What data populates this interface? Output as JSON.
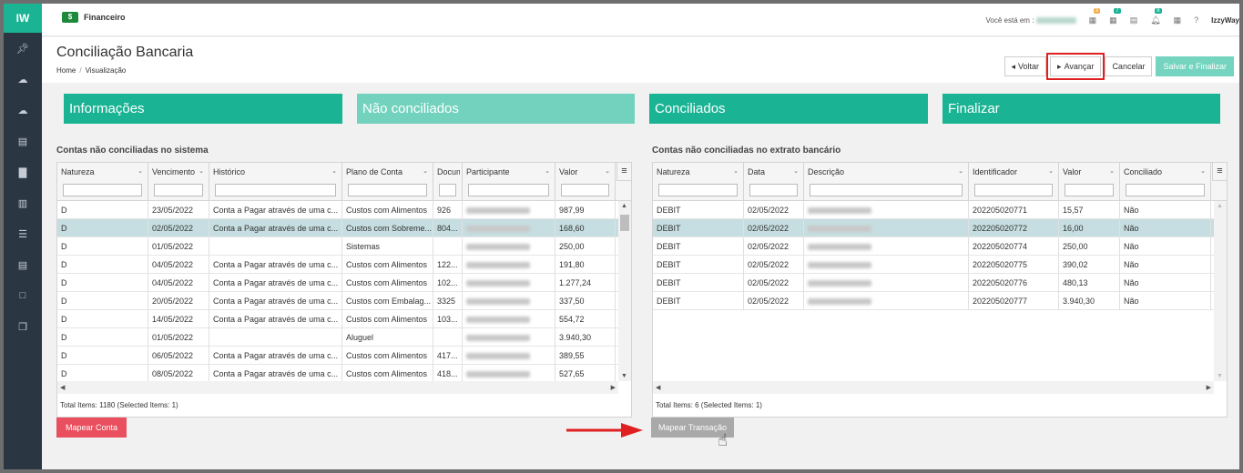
{
  "app": {
    "logo": "IW",
    "module": "Financeiro"
  },
  "topbar": {
    "location_label": "Você está em :",
    "user": "IzzyWay",
    "badges": [
      "3",
      "7",
      "8"
    ]
  },
  "sidebar": {
    "icons": [
      "pin-icon",
      "cloud-upload-icon",
      "cloud-upload-icon",
      "card-icon",
      "bar-chart-icon",
      "book-icon",
      "list-icon",
      "card-icon",
      "document-icon",
      "copy-icon"
    ]
  },
  "page": {
    "title": "Conciliação Bancaria",
    "breadcrumb": [
      "Home",
      "Visualização"
    ]
  },
  "actions": {
    "voltar": "Voltar",
    "avancar": "Avançar",
    "cancelar": "Cancelar",
    "salvar": "Salvar e Finalizar"
  },
  "steps": [
    "Informações",
    "Não conciliados",
    "Conciliados",
    "Finalizar"
  ],
  "left": {
    "title": "Contas não conciliadas no sistema",
    "columns": [
      "Natureza",
      "Vencimento",
      "Histórico",
      "Plano de Conta",
      "Documento",
      "Participante",
      "Valor"
    ],
    "rows": [
      [
        "D",
        "23/05/2022",
        "Conta a Pagar através de uma c...",
        "Custos com Alimentos",
        "926",
        "",
        "987,99"
      ],
      [
        "D",
        "02/05/2022",
        "Conta a Pagar através de uma c...",
        "Custos com Sobreme...",
        "804...",
        "",
        "168,60"
      ],
      [
        "D",
        "01/05/2022",
        "",
        "Sistemas",
        "",
        "",
        "250,00"
      ],
      [
        "D",
        "04/05/2022",
        "Conta a Pagar através de uma c...",
        "Custos com Alimentos",
        "122...",
        "",
        "191,80"
      ],
      [
        "D",
        "04/05/2022",
        "Conta a Pagar através de uma c...",
        "Custos com Alimentos",
        "102...",
        "",
        "1.277,24"
      ],
      [
        "D",
        "20/05/2022",
        "Conta a Pagar através de uma c...",
        "Custos com Embalag...",
        "3325",
        "",
        "337,50"
      ],
      [
        "D",
        "14/05/2022",
        "Conta a Pagar através de uma c...",
        "Custos com Alimentos",
        "103...",
        "",
        "554,72"
      ],
      [
        "D",
        "01/05/2022",
        "",
        "Aluguel",
        "",
        "",
        "3.940,30"
      ],
      [
        "D",
        "06/05/2022",
        "Conta a Pagar através de uma c...",
        "Custos com Alimentos",
        "417...",
        "",
        "389,55"
      ],
      [
        "D",
        "08/05/2022",
        "Conta a Pagar através de uma c...",
        "Custos com Alimentos",
        "418...",
        "",
        "527,65"
      ]
    ],
    "footer": "Total Items: 1180 (Selected Items: 1)",
    "button": "Mapear Conta"
  },
  "right": {
    "title": "Contas não conciliadas no extrato bancário",
    "columns": [
      "Natureza",
      "Data",
      "Descrição",
      "Identificador",
      "Valor",
      "Conciliado"
    ],
    "rows": [
      [
        "DEBIT",
        "02/05/2022",
        "",
        "202205020771",
        "15,57",
        "Não"
      ],
      [
        "DEBIT",
        "02/05/2022",
        "",
        "202205020772",
        "16,00",
        "Não"
      ],
      [
        "DEBIT",
        "02/05/2022",
        "",
        "202205020774",
        "250,00",
        "Não"
      ],
      [
        "DEBIT",
        "02/05/2022",
        "",
        "202205020775",
        "390,02",
        "Não"
      ],
      [
        "DEBIT",
        "02/05/2022",
        "",
        "202205020776",
        "480,13",
        "Não"
      ],
      [
        "DEBIT",
        "02/05/2022",
        "",
        "202205020777",
        "3.940,30",
        "Não"
      ]
    ],
    "footer": "Total Items: 6 (Selected Items: 1)",
    "button": "Mapear Transação"
  },
  "colors": {
    "accent": "#1ab394",
    "sidebar": "#2b3643",
    "danger": "#e94f5e",
    "selected_row": "#c6dee1"
  }
}
